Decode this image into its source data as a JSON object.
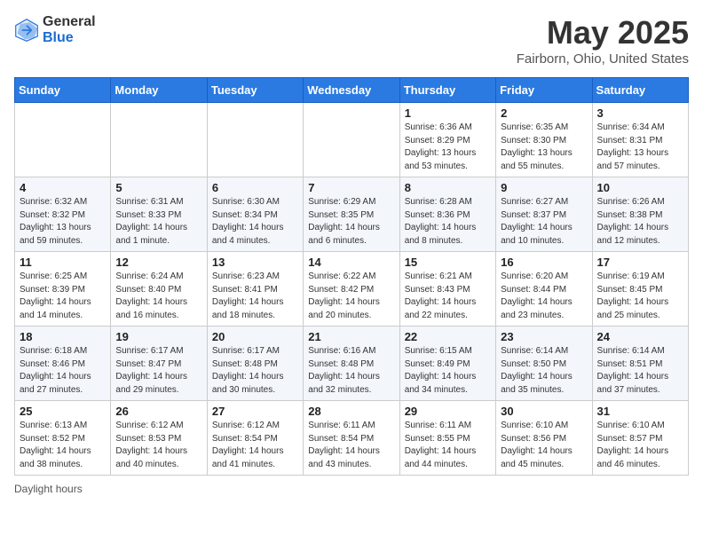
{
  "header": {
    "logo_general": "General",
    "logo_blue": "Blue",
    "title": "May 2025",
    "subtitle": "Fairborn, Ohio, United States"
  },
  "days_of_week": [
    "Sunday",
    "Monday",
    "Tuesday",
    "Wednesday",
    "Thursday",
    "Friday",
    "Saturday"
  ],
  "weeks": [
    [
      {
        "day": "",
        "info": ""
      },
      {
        "day": "",
        "info": ""
      },
      {
        "day": "",
        "info": ""
      },
      {
        "day": "",
        "info": ""
      },
      {
        "day": "1",
        "info": "Sunrise: 6:36 AM\nSunset: 8:29 PM\nDaylight: 13 hours\nand 53 minutes."
      },
      {
        "day": "2",
        "info": "Sunrise: 6:35 AM\nSunset: 8:30 PM\nDaylight: 13 hours\nand 55 minutes."
      },
      {
        "day": "3",
        "info": "Sunrise: 6:34 AM\nSunset: 8:31 PM\nDaylight: 13 hours\nand 57 minutes."
      }
    ],
    [
      {
        "day": "4",
        "info": "Sunrise: 6:32 AM\nSunset: 8:32 PM\nDaylight: 13 hours\nand 59 minutes."
      },
      {
        "day": "5",
        "info": "Sunrise: 6:31 AM\nSunset: 8:33 PM\nDaylight: 14 hours\nand 1 minute."
      },
      {
        "day": "6",
        "info": "Sunrise: 6:30 AM\nSunset: 8:34 PM\nDaylight: 14 hours\nand 4 minutes."
      },
      {
        "day": "7",
        "info": "Sunrise: 6:29 AM\nSunset: 8:35 PM\nDaylight: 14 hours\nand 6 minutes."
      },
      {
        "day": "8",
        "info": "Sunrise: 6:28 AM\nSunset: 8:36 PM\nDaylight: 14 hours\nand 8 minutes."
      },
      {
        "day": "9",
        "info": "Sunrise: 6:27 AM\nSunset: 8:37 PM\nDaylight: 14 hours\nand 10 minutes."
      },
      {
        "day": "10",
        "info": "Sunrise: 6:26 AM\nSunset: 8:38 PM\nDaylight: 14 hours\nand 12 minutes."
      }
    ],
    [
      {
        "day": "11",
        "info": "Sunrise: 6:25 AM\nSunset: 8:39 PM\nDaylight: 14 hours\nand 14 minutes."
      },
      {
        "day": "12",
        "info": "Sunrise: 6:24 AM\nSunset: 8:40 PM\nDaylight: 14 hours\nand 16 minutes."
      },
      {
        "day": "13",
        "info": "Sunrise: 6:23 AM\nSunset: 8:41 PM\nDaylight: 14 hours\nand 18 minutes."
      },
      {
        "day": "14",
        "info": "Sunrise: 6:22 AM\nSunset: 8:42 PM\nDaylight: 14 hours\nand 20 minutes."
      },
      {
        "day": "15",
        "info": "Sunrise: 6:21 AM\nSunset: 8:43 PM\nDaylight: 14 hours\nand 22 minutes."
      },
      {
        "day": "16",
        "info": "Sunrise: 6:20 AM\nSunset: 8:44 PM\nDaylight: 14 hours\nand 23 minutes."
      },
      {
        "day": "17",
        "info": "Sunrise: 6:19 AM\nSunset: 8:45 PM\nDaylight: 14 hours\nand 25 minutes."
      }
    ],
    [
      {
        "day": "18",
        "info": "Sunrise: 6:18 AM\nSunset: 8:46 PM\nDaylight: 14 hours\nand 27 minutes."
      },
      {
        "day": "19",
        "info": "Sunrise: 6:17 AM\nSunset: 8:47 PM\nDaylight: 14 hours\nand 29 minutes."
      },
      {
        "day": "20",
        "info": "Sunrise: 6:17 AM\nSunset: 8:48 PM\nDaylight: 14 hours\nand 30 minutes."
      },
      {
        "day": "21",
        "info": "Sunrise: 6:16 AM\nSunset: 8:48 PM\nDaylight: 14 hours\nand 32 minutes."
      },
      {
        "day": "22",
        "info": "Sunrise: 6:15 AM\nSunset: 8:49 PM\nDaylight: 14 hours\nand 34 minutes."
      },
      {
        "day": "23",
        "info": "Sunrise: 6:14 AM\nSunset: 8:50 PM\nDaylight: 14 hours\nand 35 minutes."
      },
      {
        "day": "24",
        "info": "Sunrise: 6:14 AM\nSunset: 8:51 PM\nDaylight: 14 hours\nand 37 minutes."
      }
    ],
    [
      {
        "day": "25",
        "info": "Sunrise: 6:13 AM\nSunset: 8:52 PM\nDaylight: 14 hours\nand 38 minutes."
      },
      {
        "day": "26",
        "info": "Sunrise: 6:12 AM\nSunset: 8:53 PM\nDaylight: 14 hours\nand 40 minutes."
      },
      {
        "day": "27",
        "info": "Sunrise: 6:12 AM\nSunset: 8:54 PM\nDaylight: 14 hours\nand 41 minutes."
      },
      {
        "day": "28",
        "info": "Sunrise: 6:11 AM\nSunset: 8:54 PM\nDaylight: 14 hours\nand 43 minutes."
      },
      {
        "day": "29",
        "info": "Sunrise: 6:11 AM\nSunset: 8:55 PM\nDaylight: 14 hours\nand 44 minutes."
      },
      {
        "day": "30",
        "info": "Sunrise: 6:10 AM\nSunset: 8:56 PM\nDaylight: 14 hours\nand 45 minutes."
      },
      {
        "day": "31",
        "info": "Sunrise: 6:10 AM\nSunset: 8:57 PM\nDaylight: 14 hours\nand 46 minutes."
      }
    ]
  ],
  "footer": {
    "daylight_label": "Daylight hours"
  }
}
